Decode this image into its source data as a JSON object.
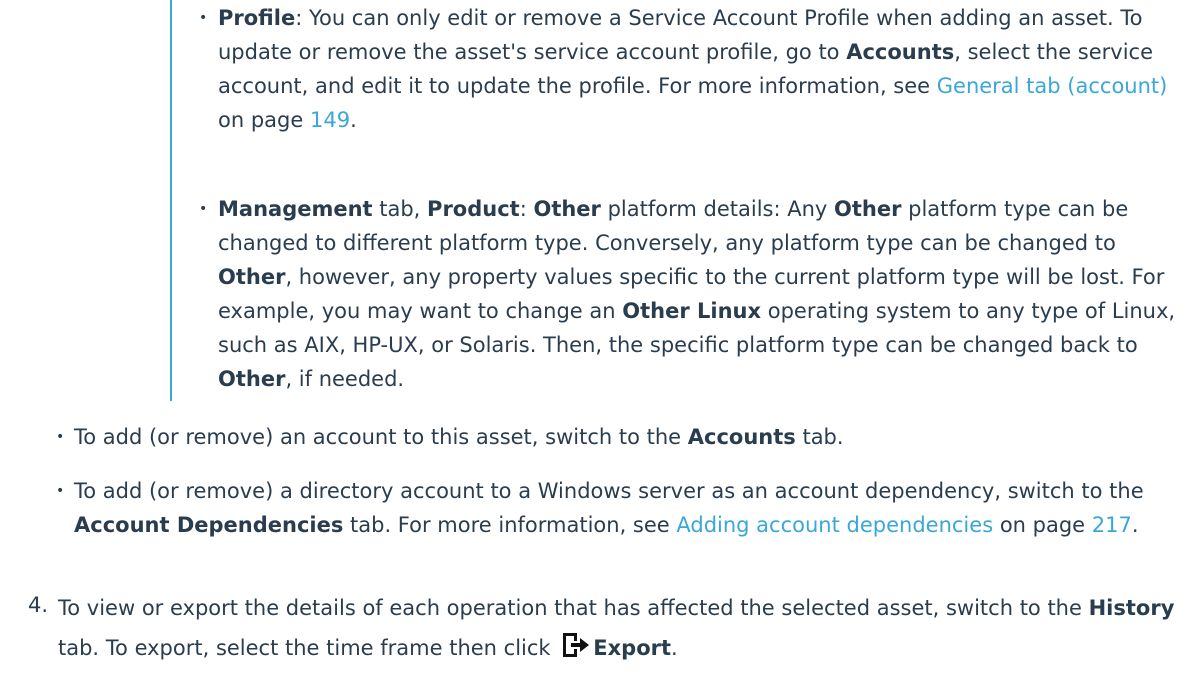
{
  "items": {
    "profile": {
      "label": "Profile",
      "text1": ": You can only edit or remove a Service Account Profile when adding an asset. To update or remove the asset's service account profile, go to ",
      "accounts": "Accounts",
      "text2": ", select the service account, and edit it to update the profile. For more information, see ",
      "link": "General tab (account)",
      "text3": " on page ",
      "page": "149",
      "end": "."
    },
    "management": {
      "label1": "Management",
      "text1": " tab, ",
      "label2": "Product",
      "text2": ": ",
      "label3": "Other",
      "text3": " platform details: Any ",
      "label4": "Other",
      "text4": " platform type can be changed to different platform type. Conversely, any platform type can be changed to ",
      "label5": "Other",
      "text5": ", however, any property values specific to the current platform type will be lost. For example, you may want to change an ",
      "label6": "Other Linux",
      "text6": " operating system to any type of Linux, such as AIX, HP-UX, or Solaris. Then, the specific platform type can be changed back to ",
      "label7": "Other",
      "text7": ", if needed."
    },
    "add_account": {
      "text1": "To add (or remove) an account to this asset, switch to the ",
      "label": "Accounts",
      "text2": " tab."
    },
    "add_directory": {
      "text1": "To add (or remove) a directory account to a Windows server as an account dependency, switch to the ",
      "label": "Account Dependencies",
      "text2": " tab. For more information, see ",
      "link": "Adding account dependencies",
      "text3": " on page ",
      "page": "217",
      "end": "."
    }
  },
  "step4": {
    "number": "4.",
    "text1": "To view or export the details of each operation that has affected the selected asset, switch to the ",
    "label": "History",
    "text2": " tab. To export, select the time frame then click ",
    "export_icon": "export-icon",
    "export": "Export",
    "end": "."
  },
  "bullet_glyph": "•",
  "colors": {
    "text": "#2a3d4f",
    "link": "#3aa7d9",
    "bar": "#3aa7d9"
  }
}
